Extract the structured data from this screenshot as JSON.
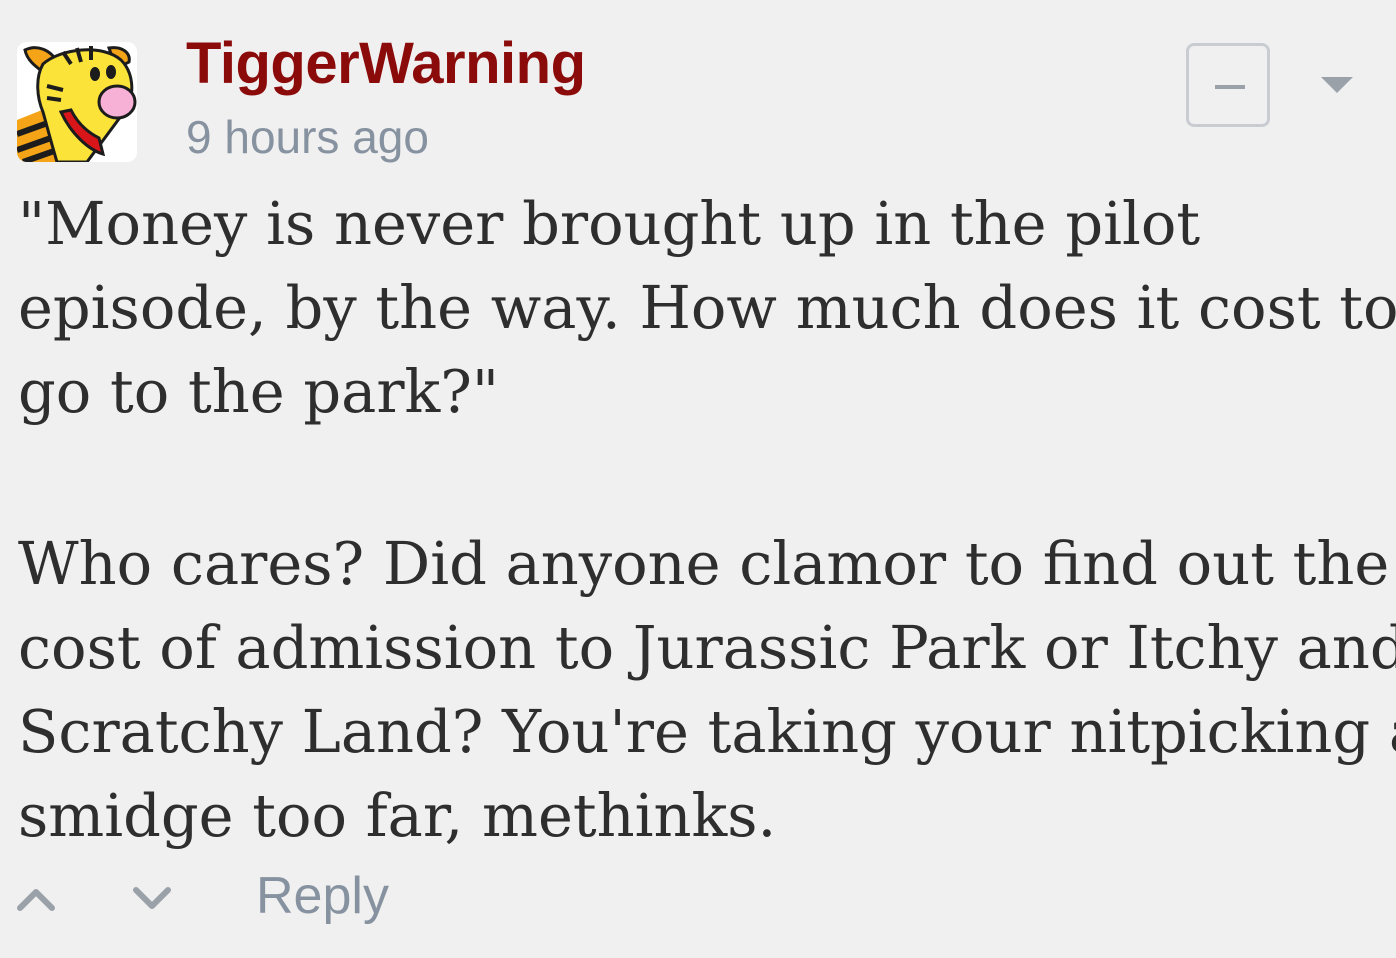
{
  "comment": {
    "author": "TiggerWarning",
    "timestamp": "9 hours ago",
    "avatar_icon": "tigger-avatar-icon",
    "paragraphs": [
      [
        "\"Money is never brought up in the pilot",
        "episode, by the way. How much does it cost to",
        "go to the park?\""
      ],
      [
        "Who cares? Did anyone clamor to find out the",
        "cost of admission to Jurassic Park or Itchy and",
        "Scratchy Land? You're taking your nitpicking a",
        "smidge too far, methinks."
      ]
    ]
  },
  "actions": {
    "upvote_icon": "chevron-up-icon",
    "downvote_icon": "chevron-down-icon",
    "reply_label": "Reply"
  },
  "controls": {
    "collapse_icon": "minus-icon",
    "menu_icon": "caret-down-icon"
  },
  "colors": {
    "background": "#f0f0f0",
    "author": "#8b0a0a",
    "meta": "#8792a0",
    "body_text": "#2e2e2e"
  }
}
